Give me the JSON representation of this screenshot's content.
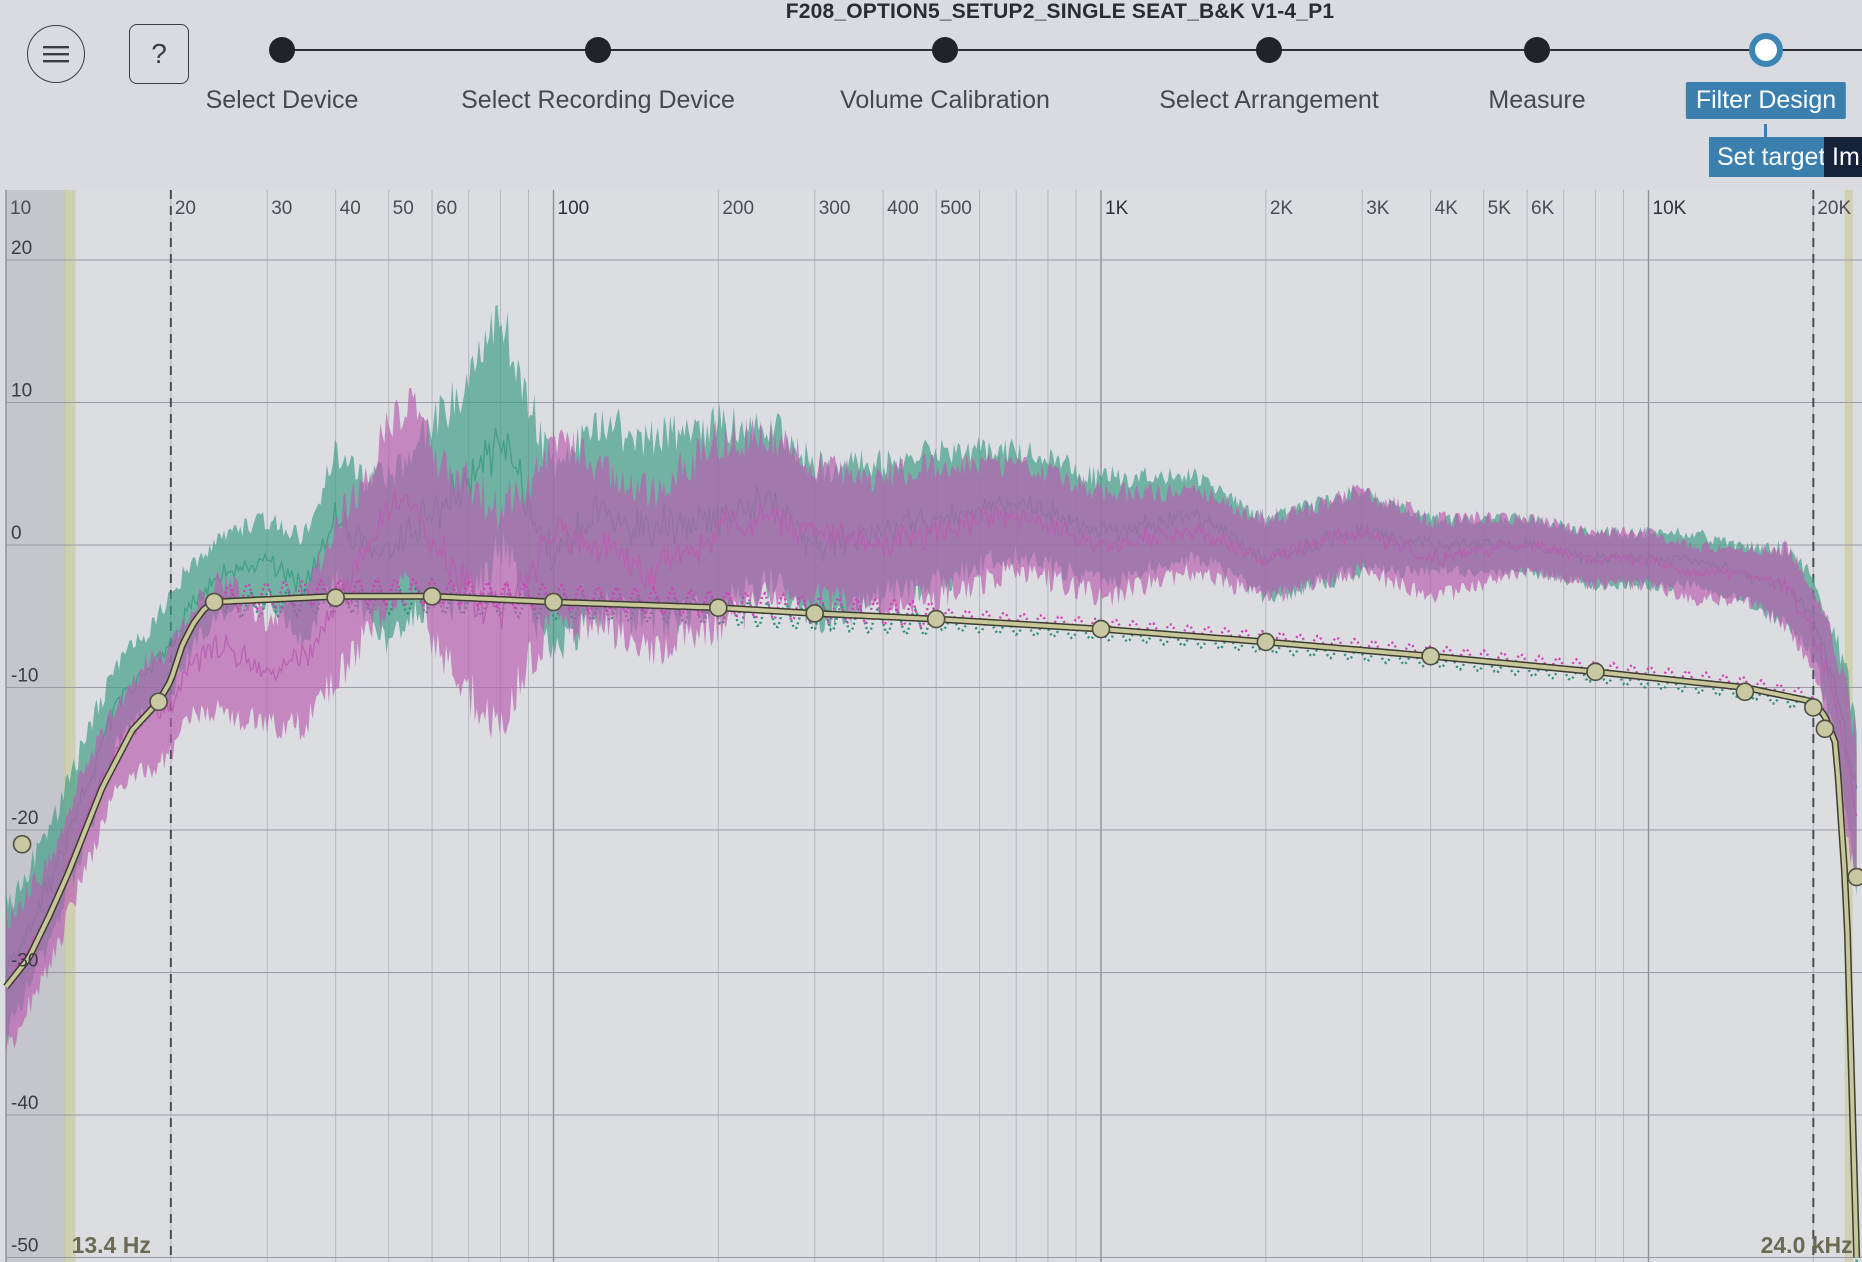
{
  "app": {
    "project_title": "F208_OPTION5_SETUP2_SINGLE SEAT_B&K V1-4_P1"
  },
  "toolbar": {
    "menu_icon": "hamburger-menu-icon",
    "help_label": "?"
  },
  "steps": [
    {
      "label": "Select Device",
      "state": "done"
    },
    {
      "label": "Select Recording Device",
      "state": "done"
    },
    {
      "label": "Volume Calibration",
      "state": "done"
    },
    {
      "label": "Select Arrangement",
      "state": "done"
    },
    {
      "label": "Measure",
      "state": "done"
    },
    {
      "label": "Filter Design",
      "state": "active"
    }
  ],
  "subactions": {
    "set_target_label": "Set target",
    "import_label": "Im"
  },
  "colors": {
    "accent": "#3a7fae",
    "background": "#dcdde1",
    "series_green": "#3f9e86",
    "series_magenta": "#b95fb1",
    "target_curve": "#c7c79a",
    "limit_band": "#c9ca9c"
  },
  "chart_data": {
    "type": "line",
    "x_scale": "log",
    "x_range_hz": [
      10,
      24000
    ],
    "y_range_db": [
      -50,
      20
    ],
    "x_tick_labels": [
      "10",
      "20",
      "30",
      "40",
      "50",
      "60",
      "100",
      "200",
      "300",
      "400",
      "500",
      "1K",
      "2K",
      "3K",
      "4K",
      "5K",
      "6K",
      "10K",
      "20K"
    ],
    "x_tick_values": [
      10,
      20,
      30,
      40,
      50,
      60,
      100,
      200,
      300,
      400,
      500,
      1000,
      2000,
      3000,
      4000,
      5000,
      6000,
      10000,
      20000
    ],
    "y_tick_labels": [
      "20",
      "10",
      "0",
      "-10",
      "-20",
      "-30",
      "-40",
      "-50"
    ],
    "y_tick_values": [
      20,
      10,
      0,
      -10,
      -20,
      -30,
      -40,
      -50
    ],
    "filter_low_hz": 20,
    "filter_high_hz": 20000,
    "lower_bound_label": "13.4 Hz",
    "upper_bound_label": "24.0 kHz",
    "series": [
      {
        "role": "measurement-green",
        "color": "#3f9e86",
        "freqs": [
          10,
          12,
          14,
          16,
          18,
          20,
          22,
          25,
          30,
          35,
          40,
          45,
          50,
          55,
          60,
          70,
          80,
          90,
          100,
          120,
          150,
          200,
          250,
          300,
          400,
          500,
          700,
          1000,
          1500,
          2000,
          3000,
          4000,
          6000,
          8000,
          10000,
          12000,
          15000,
          18000,
          20000,
          22000,
          24000
        ],
        "mid": [
          -30,
          -24,
          -17,
          -11,
          -9,
          -7,
          -4,
          -2,
          -1,
          -3,
          2,
          0,
          -1,
          1,
          2,
          4,
          8,
          3,
          -1,
          2,
          1,
          2,
          3,
          0,
          1,
          2,
          3,
          1,
          2,
          -1,
          1,
          0,
          0,
          -1,
          -1,
          -1,
          -2,
          -3,
          -5,
          -10,
          -18
        ],
        "spread": [
          5,
          4,
          4,
          3,
          3,
          4,
          3,
          3,
          3,
          4,
          5,
          5,
          6,
          6,
          7,
          8,
          9,
          8,
          7,
          7,
          7,
          7,
          6,
          6,
          5,
          5,
          4,
          4,
          3,
          3,
          3,
          2,
          2,
          2,
          2,
          2,
          2,
          3,
          3,
          4,
          6
        ]
      },
      {
        "role": "measurement-magenta",
        "color": "#b95fb1",
        "freqs": [
          10,
          12,
          14,
          16,
          18,
          20,
          22,
          25,
          30,
          35,
          40,
          45,
          50,
          55,
          60,
          70,
          80,
          90,
          100,
          120,
          150,
          200,
          250,
          300,
          400,
          500,
          700,
          1000,
          1500,
          2000,
          3000,
          4000,
          6000,
          8000,
          10000,
          12000,
          15000,
          18000,
          20000,
          22000,
          24000
        ],
        "mid": [
          -31,
          -26,
          -19,
          -14,
          -12,
          -11,
          -8,
          -7,
          -9,
          -8,
          -4,
          -1,
          2,
          4,
          0,
          -3,
          -5,
          -2,
          1,
          0,
          -2,
          1,
          2,
          1,
          0,
          1,
          2,
          0,
          1,
          -1,
          1,
          -1,
          0,
          -1,
          -1,
          -2,
          -2,
          -3,
          -6,
          -11,
          -19
        ],
        "spread": [
          5,
          4,
          4,
          3,
          4,
          4,
          4,
          5,
          4,
          5,
          6,
          6,
          7,
          7,
          7,
          8,
          8,
          7,
          7,
          6,
          6,
          7,
          6,
          5,
          5,
          5,
          4,
          4,
          3,
          3,
          3,
          3,
          2,
          2,
          2,
          2,
          2,
          3,
          3,
          4,
          6
        ]
      }
    ],
    "target_curve": {
      "color": "#c7c79a",
      "freqs": [
        10,
        11,
        12,
        13,
        15,
        17,
        19,
        20,
        21,
        22,
        23,
        24,
        40,
        60,
        100,
        200,
        300,
        500,
        1000,
        2000,
        4000,
        8000,
        15000,
        20000,
        21000,
        22000,
        23000,
        24000
      ],
      "db": [
        -31,
        -29,
        -26,
        -23,
        -17,
        -13,
        -11,
        -9.5,
        -7,
        -5.5,
        -4.5,
        -4,
        -3.6,
        -3.6,
        -4,
        -4.4,
        -4.8,
        -5.2,
        -5.9,
        -6.8,
        -7.8,
        -8.9,
        -10,
        -11,
        -12,
        -14,
        -25,
        -50
      ]
    },
    "target_points_hz": [
      10.7,
      19,
      24,
      40,
      60,
      100,
      200,
      300,
      500,
      1000,
      2000,
      4000,
      8000,
      15000,
      20000,
      21000,
      24000
    ],
    "target_points_db": [
      -21,
      -11,
      -4,
      -3.7,
      -3.6,
      -4,
      -4.4,
      -4.8,
      -5.2,
      -5.9,
      -6.8,
      -7.8,
      -8.9,
      -10.3,
      -11.4,
      -12.9,
      -23.3
    ]
  }
}
